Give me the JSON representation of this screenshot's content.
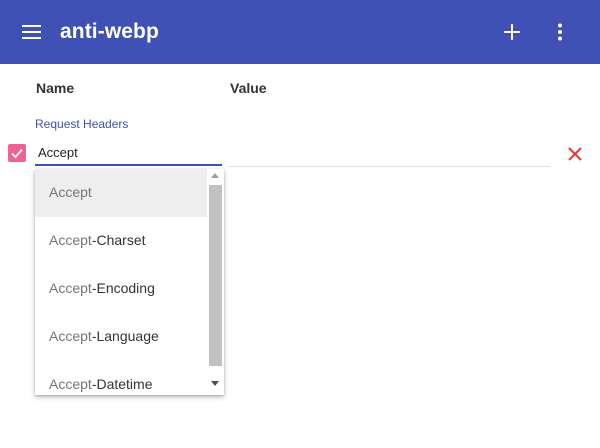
{
  "app": {
    "title": "anti-webp",
    "primary_color": "#3f51b5",
    "accent_color": "#f06292",
    "icons": {
      "menu": "hamburger-menu-icon",
      "add": "plus-icon",
      "more": "more-vert-icon",
      "delete": "close-x-icon",
      "check": "check-icon"
    }
  },
  "table": {
    "columns": [
      "Name",
      "Value"
    ],
    "section_label": "Request Headers",
    "row": {
      "checked": true,
      "name_value": "Accept",
      "value_value": ""
    }
  },
  "autocomplete": {
    "typed_prefix": "Accept",
    "options": [
      {
        "match": "Accept",
        "rest": ""
      },
      {
        "match": "Accept",
        "rest": "-Charset"
      },
      {
        "match": "Accept",
        "rest": "-Encoding"
      },
      {
        "match": "Accept",
        "rest": "-Language"
      },
      {
        "match": "Accept",
        "rest": "-Datetime"
      }
    ]
  }
}
